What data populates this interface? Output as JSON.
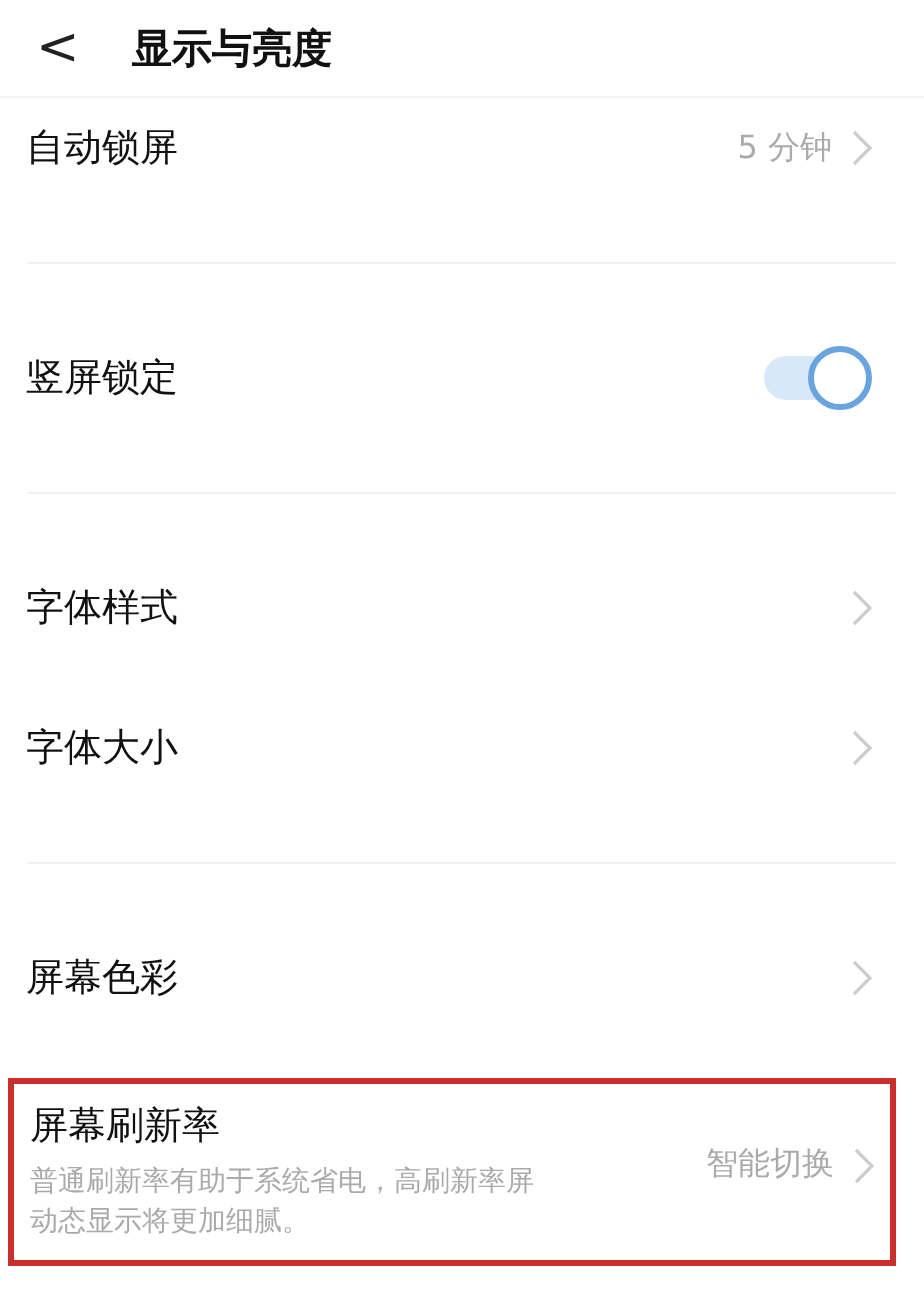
{
  "header": {
    "back": "<",
    "title": "显示与亮度"
  },
  "groups": [
    {
      "items": [
        {
          "kind": "value",
          "label": "自动锁屏",
          "value": "5 分钟"
        }
      ]
    },
    {
      "items": [
        {
          "kind": "toggle",
          "label": "竖屏锁定",
          "on": true
        }
      ]
    },
    {
      "items": [
        {
          "kind": "link",
          "label": "字体样式"
        },
        {
          "kind": "link",
          "label": "字体大小"
        }
      ]
    },
    {
      "items": [
        {
          "kind": "link",
          "label": "屏幕色彩"
        },
        {
          "kind": "detail",
          "label": "屏幕刷新率",
          "value": "智能切换",
          "description": [
            "普通刷新率有助于系统省电，高刷新率屏",
            "动态显示将更加细腻。"
          ],
          "highlighted": true
        }
      ]
    }
  ]
}
